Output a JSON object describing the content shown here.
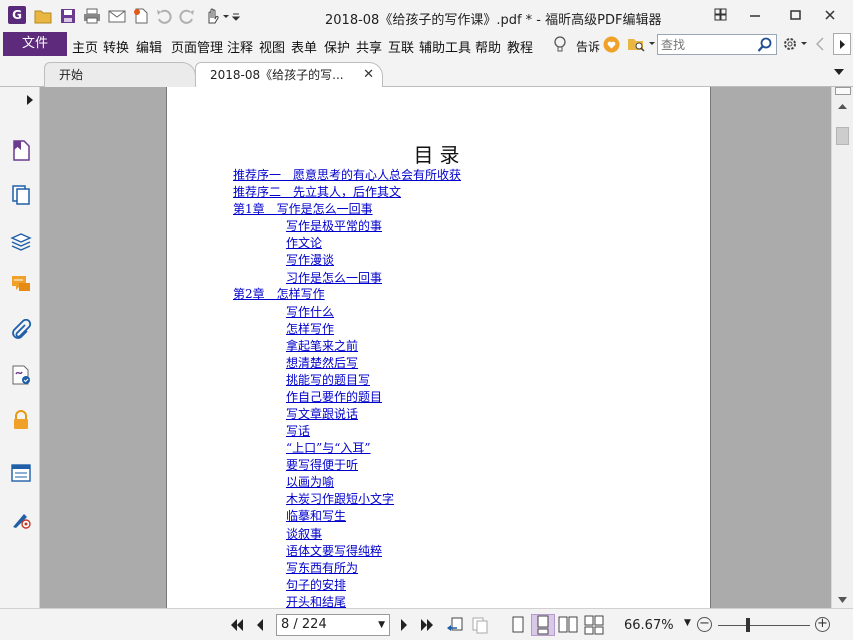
{
  "window": {
    "title": "2018-08《给孩子的写作课》.pdf * - 福昕高级PDF编辑器"
  },
  "menu": {
    "file_label": "文件",
    "items": [
      "主页",
      "转换",
      "编辑",
      "页面管理",
      "注释",
      "视图",
      "表单",
      "保护",
      "共享",
      "互联",
      "辅助工具",
      "帮助",
      "教程"
    ],
    "tell_me_label": "告诉",
    "search_placeholder": "查找"
  },
  "tabs": [
    {
      "label": "开始"
    },
    {
      "label": "2018-08《给孩子的写..."
    }
  ],
  "document": {
    "toc_title": "目录",
    "toc": [
      {
        "text": "推荐序一　愿意思考的有心人总会有所收获",
        "level": 0
      },
      {
        "text": "推荐序二　先立其人，后作其文",
        "level": 0
      },
      {
        "text": "第1章　写作是怎么一回事",
        "level": 0
      },
      {
        "text": "写作是极平常的事",
        "level": 1
      },
      {
        "text": "作文论",
        "level": 1
      },
      {
        "text": "写作漫谈",
        "level": 1
      },
      {
        "text": "习作是怎么一回事",
        "level": 1
      },
      {
        "text": "第2章　怎样写作",
        "level": 0
      },
      {
        "text": "写作什么",
        "level": 1
      },
      {
        "text": "怎样写作",
        "level": 1
      },
      {
        "text": "拿起笔来之前",
        "level": 1
      },
      {
        "text": "想清楚然后写",
        "level": 1
      },
      {
        "text": "挑能写的题目写",
        "level": 1
      },
      {
        "text": "作自己要作的题目",
        "level": 1
      },
      {
        "text": "写文章跟说话",
        "level": 1
      },
      {
        "text": "写话",
        "level": 1
      },
      {
        "text": "“上口”与“入耳”",
        "level": 1
      },
      {
        "text": "要写得便于听",
        "level": 1
      },
      {
        "text": "以画为喻",
        "level": 1
      },
      {
        "text": "木炭习作跟短小文字",
        "level": 1
      },
      {
        "text": "临摹和写生",
        "level": 1
      },
      {
        "text": "谈叙事",
        "level": 1
      },
      {
        "text": "语体文要写得纯粹",
        "level": 1
      },
      {
        "text": "写东西有所为",
        "level": 1
      },
      {
        "text": "句子的安排",
        "level": 1
      },
      {
        "text": "开头和结尾",
        "level": 1
      }
    ]
  },
  "status": {
    "page_value": "8 / 224",
    "zoom": "66.67%"
  },
  "colors": {
    "accent": "#5d2a7c",
    "link": "#0000cc",
    "doc_background": "#ababab"
  }
}
